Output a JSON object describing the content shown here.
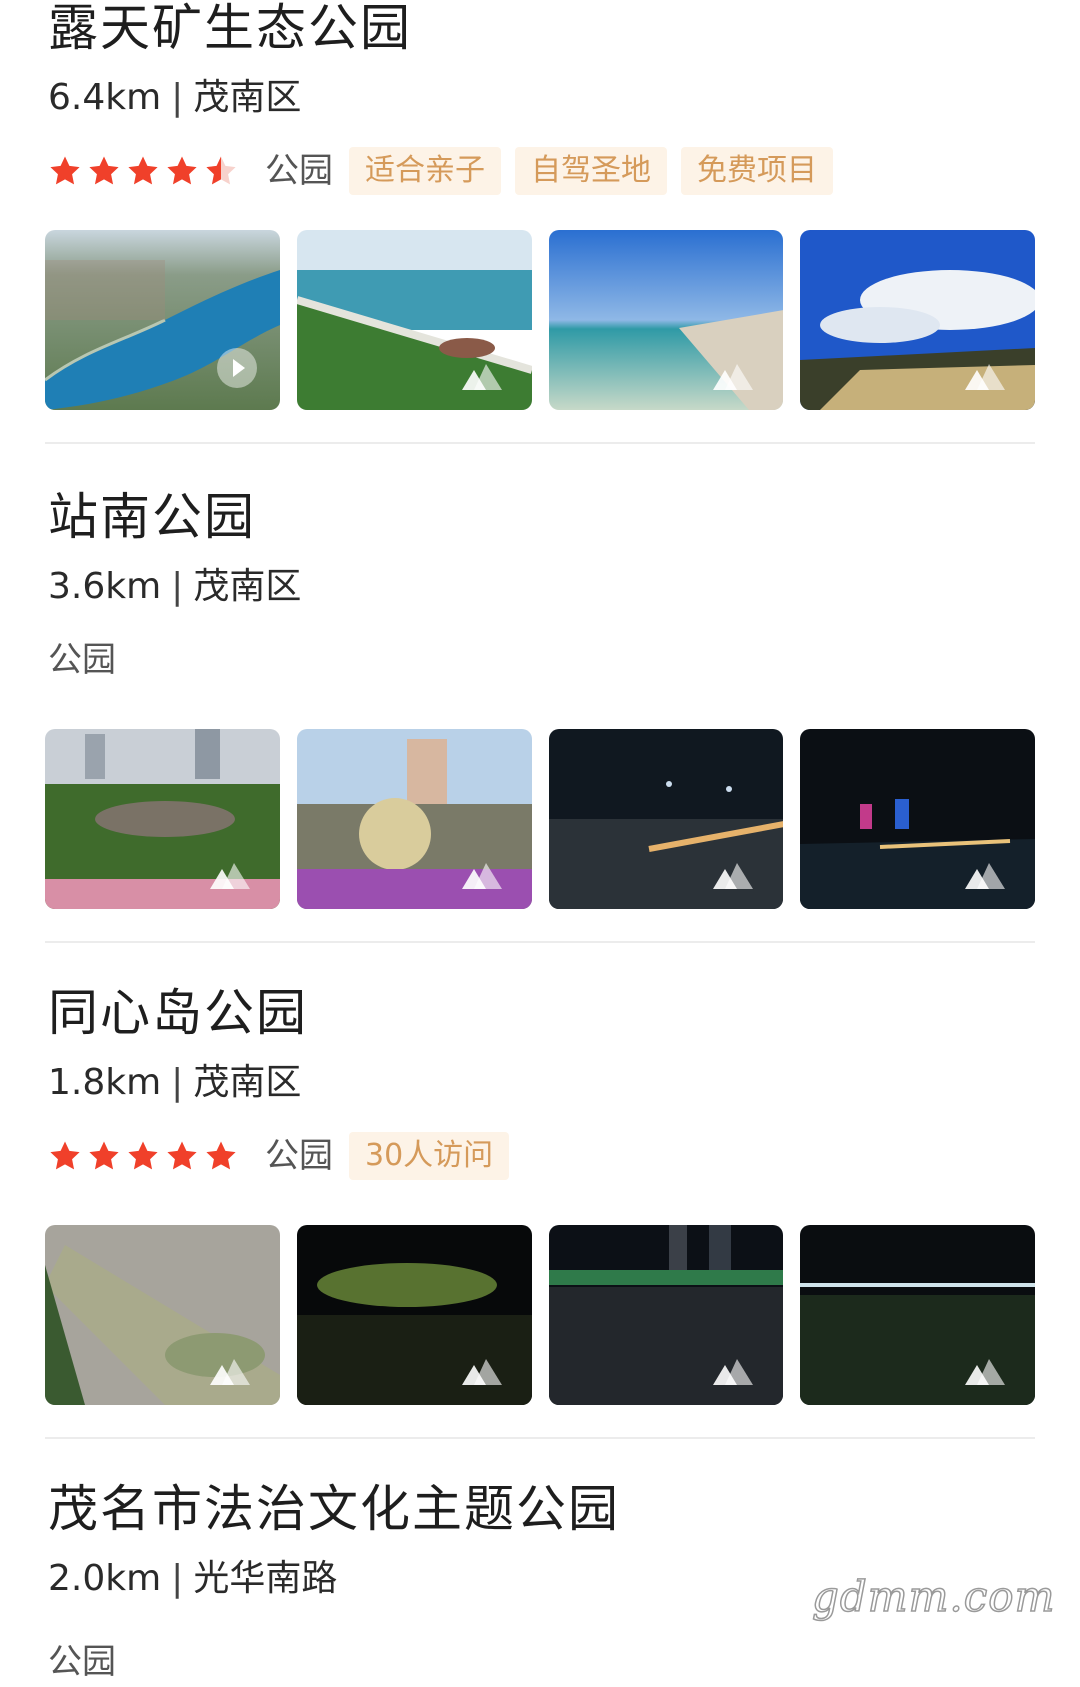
{
  "colors": {
    "star": "#f0402a",
    "tag_text": "#d59a5a",
    "tag_bg": "#fdf3e7",
    "divider": "#ececec"
  },
  "parks": [
    {
      "name": "露天矿生态公园",
      "distance": "6.4km",
      "district": "茂南区",
      "rating_stars": 4.5,
      "category": "公园",
      "tags": [
        "适合亲子",
        "自驾圣地",
        "免费项目"
      ],
      "photos": [
        "lake-aerial-photo",
        "lake-shore-walkway-photo",
        "beach-water-photo",
        "blue-sky-field-photo"
      ]
    },
    {
      "name": "站南公园",
      "distance": "3.6km",
      "district": "茂南区",
      "rating_stars": 0,
      "category": "公园",
      "tags": [],
      "photos": [
        "garden-flowerbed-photo",
        "peacock-sculpture-photo",
        "night-riverside-photo",
        "night-city-lights-photo"
      ]
    },
    {
      "name": "同心岛公园",
      "distance": "1.8km",
      "district": "茂南区",
      "rating_stars": 5,
      "category": "公园",
      "tags": [
        "30人访问"
      ],
      "photos": [
        "river-island-aerial-photo",
        "night-lit-tree-photo",
        "night-plaza-photo",
        "night-lawn-photo"
      ]
    },
    {
      "name": "茂名市法治文化主题公园",
      "distance": "2.0km",
      "district": "光华南路",
      "category": "公园"
    }
  ],
  "watermark": "gdmm.com"
}
